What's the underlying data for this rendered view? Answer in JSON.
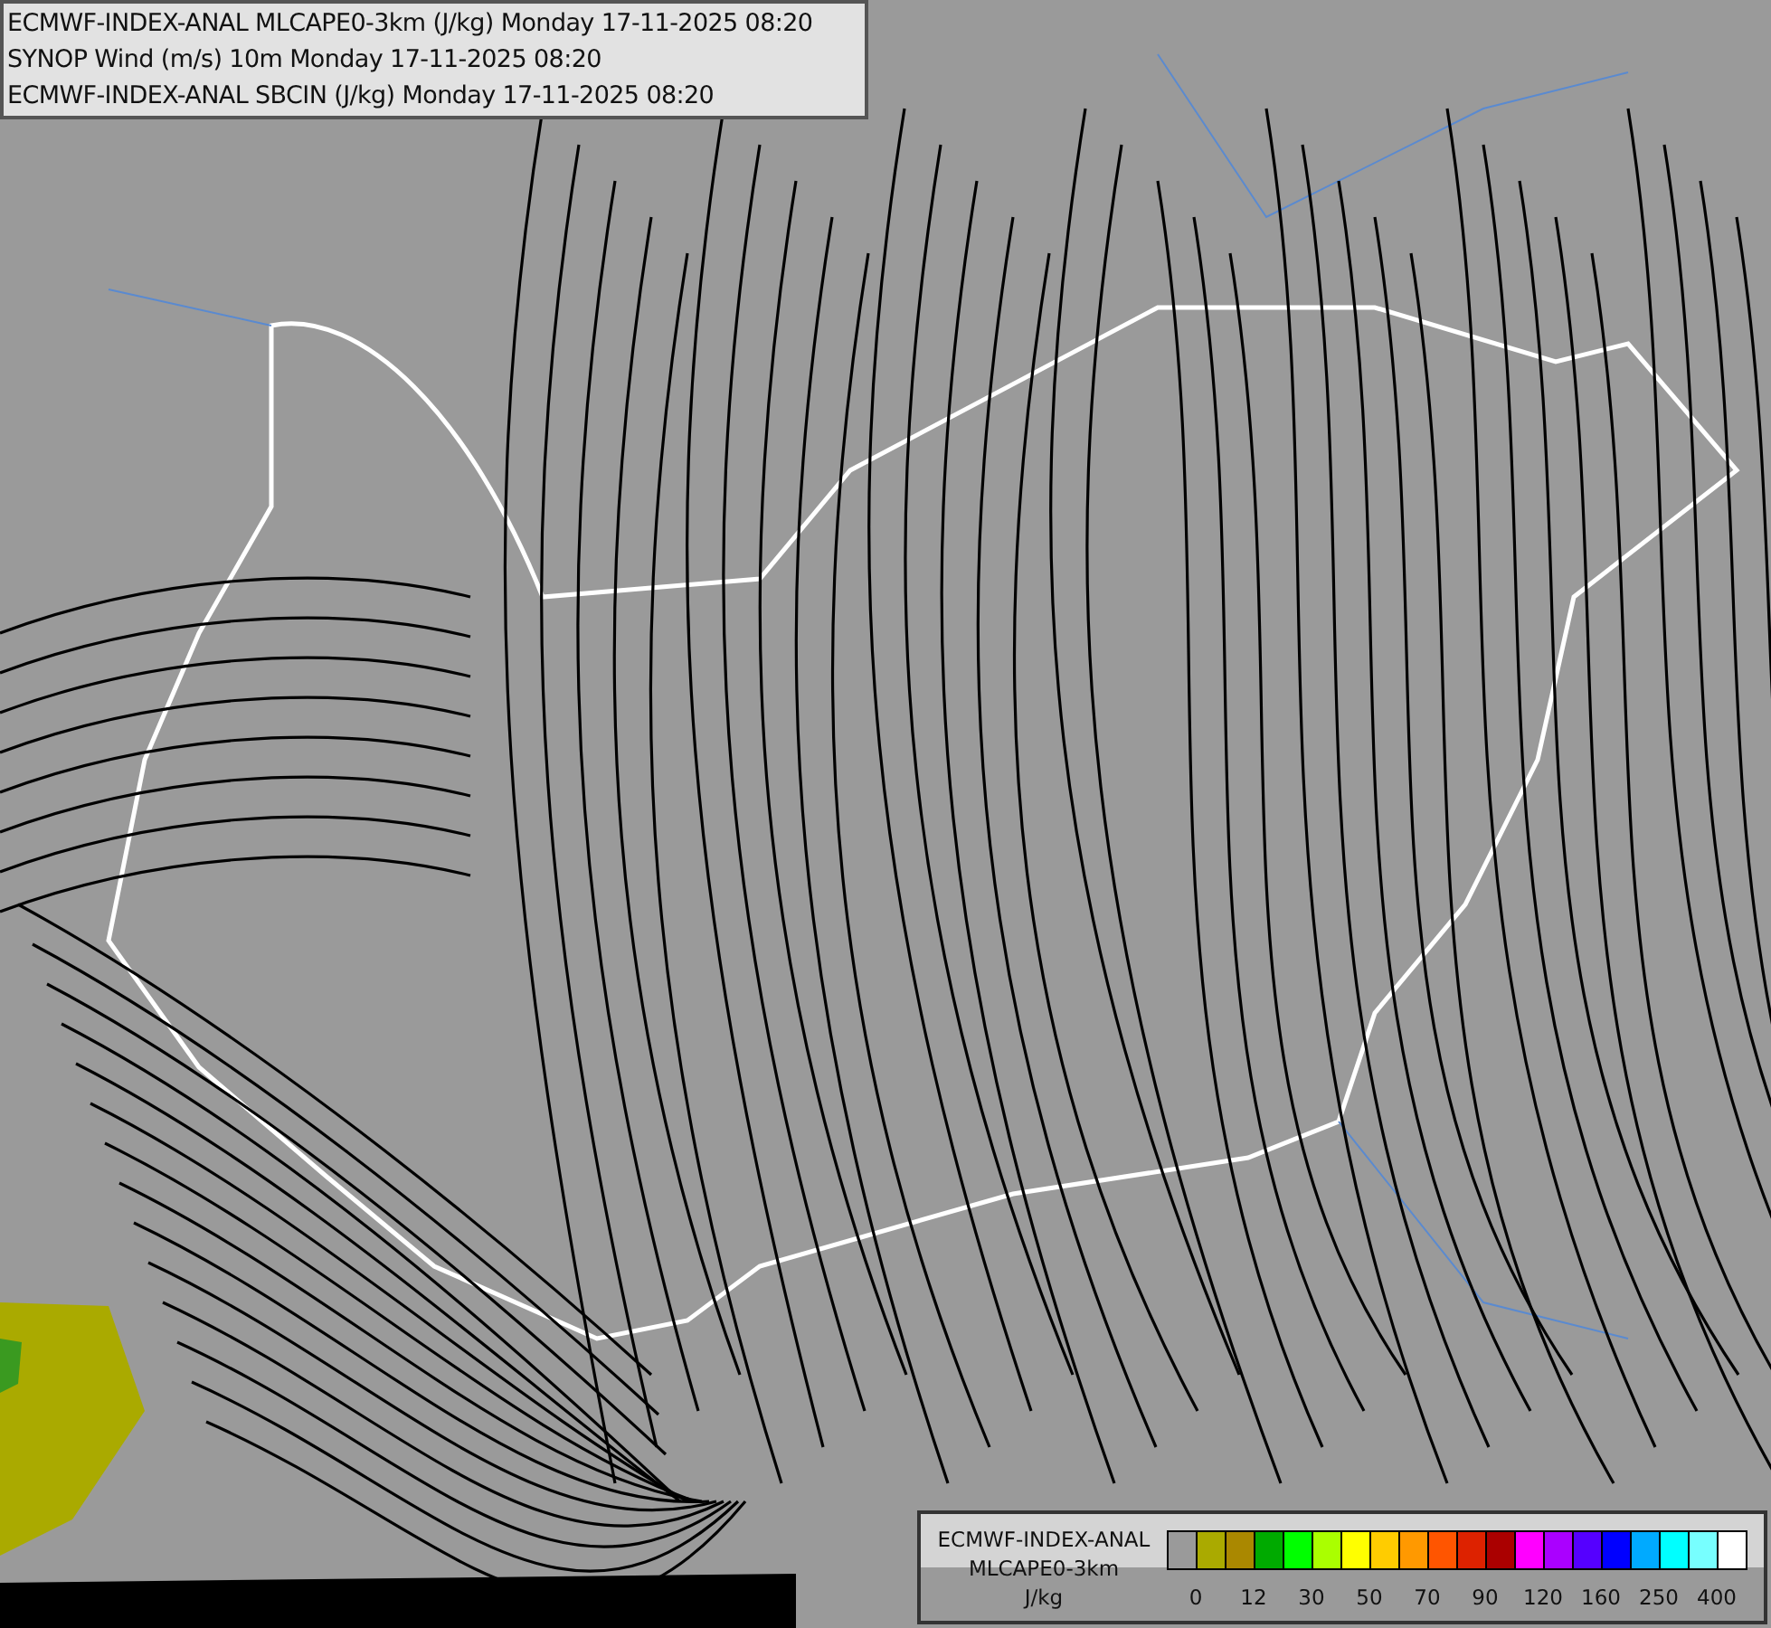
{
  "header": {
    "lines": [
      "ECMWF-INDEX-ANAL MLCAPE0-3km (J/kg) Monday 17-11-2025 08:20",
      "SYNOP Wind (m/s) 10m Monday 17-11-2025 08:20",
      "ECMWF-INDEX-ANAL SBCIN (J/kg) Monday 17-11-2025 08:20"
    ]
  },
  "legend": {
    "title_lines": [
      "ECMWF-INDEX-ANAL",
      "MLCAPE0-3km",
      "J/kg"
    ],
    "swatches": [
      {
        "color": "#9a9a9a"
      },
      {
        "color": "#aaaa00"
      },
      {
        "color": "#aa8800"
      },
      {
        "color": "#00aa00"
      },
      {
        "color": "#00ff00"
      },
      {
        "color": "#aaff00"
      },
      {
        "color": "#ffff00"
      },
      {
        "color": "#ffcc00"
      },
      {
        "color": "#ff9900"
      },
      {
        "color": "#ff5500"
      },
      {
        "color": "#dd2200"
      },
      {
        "color": "#aa0000"
      },
      {
        "color": "#ff00ff"
      },
      {
        "color": "#aa00ff"
      },
      {
        "color": "#5500ff"
      },
      {
        "color": "#0000ff"
      },
      {
        "color": "#00aaff"
      },
      {
        "color": "#00ffff"
      },
      {
        "color": "#77ffff"
      },
      {
        "color": "#ffffff"
      }
    ],
    "ticks": [
      "0",
      "12",
      "30",
      "50",
      "70",
      "90",
      "120",
      "160",
      "250",
      "400"
    ]
  }
}
